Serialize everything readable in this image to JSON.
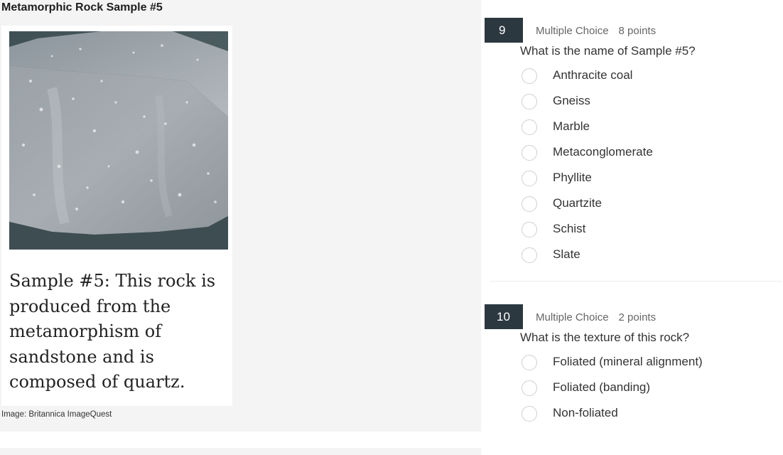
{
  "sample": {
    "title": "Metamorphic Rock Sample #5",
    "caption": "Sample #5: This rock is produced from the metamorphism of sandstone and is composed of quartz.",
    "credit": "Image: Britannica ImageQuest",
    "image_icon": "quartzite-rock-photo"
  },
  "questions": [
    {
      "number": "9",
      "type": "Multiple Choice",
      "points": "8 points",
      "text": "What is the name of Sample #5?",
      "options": [
        "Anthracite coal",
        "Gneiss",
        "Marble",
        "Metaconglomerate",
        "Phyllite",
        "Quartzite",
        "Schist",
        "Slate"
      ]
    },
    {
      "number": "10",
      "type": "Multiple Choice",
      "points": "2 points",
      "text": "What is the texture of this rock?",
      "options": [
        "Foliated (mineral alignment)",
        "Foliated (banding)",
        "Non-foliated"
      ]
    }
  ],
  "colors": {
    "number_badge": "#2c3840",
    "panel_background": "#f4f4f4",
    "radio_border": "#cfcfcf"
  }
}
